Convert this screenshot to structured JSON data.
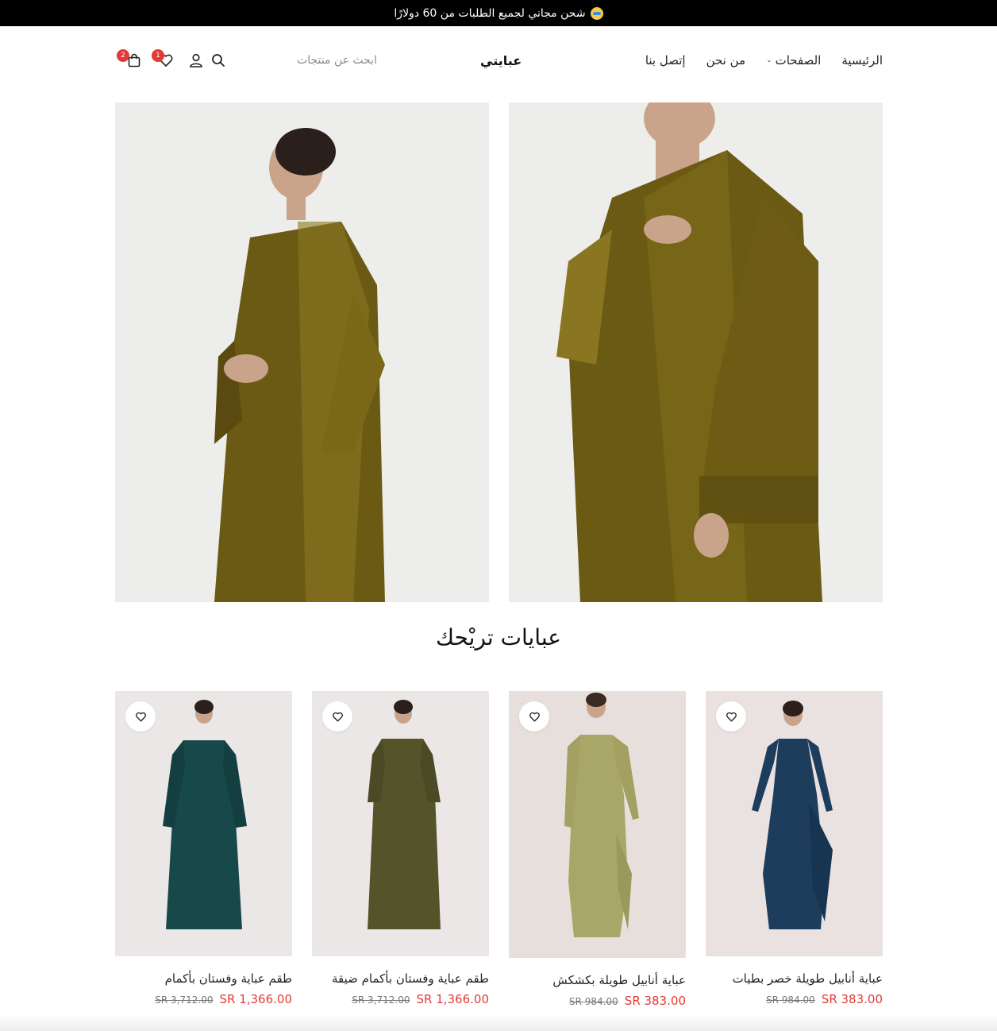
{
  "announcement": {
    "text": "شحن مجاني لجميع الطلبات من 60 دولارًا",
    "emoji_icon": "smiling-face-emoji"
  },
  "nav": {
    "items": [
      {
        "label": "الرئيسية"
      },
      {
        "label": "الصفحات",
        "has_dropdown": true
      },
      {
        "label": "من نحن"
      },
      {
        "label": "إتصل بنا"
      }
    ]
  },
  "logo": {
    "text": "عبايتي"
  },
  "search": {
    "placeholder": "ابحث عن منتجات",
    "icon": "search-icon"
  },
  "header_icons": {
    "account_icon": "user-icon",
    "wishlist": {
      "icon": "heart-icon",
      "count": "1"
    },
    "cart": {
      "icon": "shopping-bag-icon",
      "count": "2"
    }
  },
  "hero_images": [
    {
      "alt": "olive organza abaya front",
      "color": "#6b5a14"
    },
    {
      "alt": "olive organza abaya close-up",
      "color": "#6b5a14"
    }
  ],
  "section": {
    "title": "عبايات تريْحك"
  },
  "products": [
    {
      "name": "عباية أنابيل طويلة خصر بطيات",
      "price": "SR 383.00",
      "old_price": "SR 984.00",
      "color": "#1d3d5c",
      "wish_icon": "heart-icon"
    },
    {
      "name": "عباية أنابيل طويلة بكشكش",
      "price": "SR 383.00",
      "old_price": "SR 984.00",
      "color": "#a9a767",
      "wish_icon": "heart-icon"
    },
    {
      "name": "طقم عباية وفستان بأكمام ضيقة",
      "price": "SR 1,366.00",
      "old_price": "SR 3,712.00",
      "color": "#55532a",
      "wish_icon": "heart-icon"
    },
    {
      "name": "طقم عباية وفستان بأكمام",
      "price": "SR 1,366.00",
      "old_price": "SR 3,712.00",
      "color": "#17494a",
      "wish_icon": "heart-icon"
    }
  ],
  "colors": {
    "announcement_bg": "#000000",
    "sale_price": "#e53935",
    "badge": "#e53935"
  }
}
